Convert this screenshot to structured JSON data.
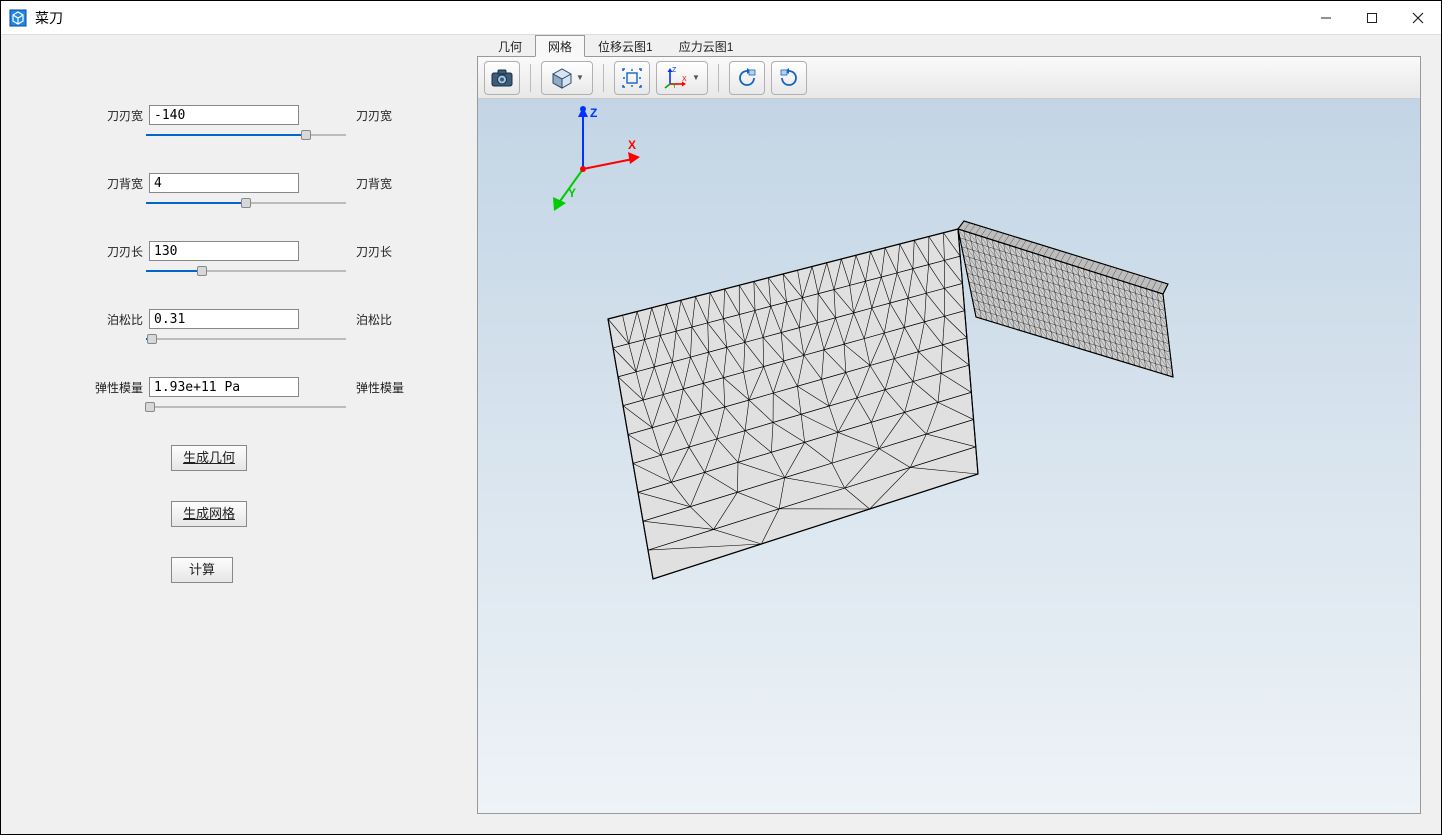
{
  "window": {
    "title": "菜刀"
  },
  "params": [
    {
      "label": "刀刃宽",
      "value": "-140",
      "label_r": "刀刃宽",
      "fill_pct": 80,
      "thumb_pct": 80
    },
    {
      "label": "刀背宽",
      "value": "4",
      "label_r": "刀背宽",
      "fill_pct": 50,
      "thumb_pct": 50
    },
    {
      "label": "刀刃长",
      "value": "130",
      "label_r": "刀刃长",
      "fill_pct": 28,
      "thumb_pct": 28
    },
    {
      "label": "泊松比",
      "value": "0.31",
      "label_r": "泊松比",
      "fill_pct": 3,
      "thumb_pct": 3
    },
    {
      "label": "弹性模量",
      "value": "1.93e+11 Pa",
      "label_r": "弹性模量",
      "fill_pct": 2,
      "thumb_pct": 2
    }
  ],
  "buttons": {
    "gen_geom": "生成几何",
    "gen_mesh": "生成网格",
    "compute": "计算"
  },
  "tabs": [
    {
      "label": "几何",
      "active": false
    },
    {
      "label": "网格",
      "active": true
    },
    {
      "label": "位移云图1",
      "active": false
    },
    {
      "label": "应力云图1",
      "active": false
    }
  ],
  "axes": {
    "x": "X",
    "y": "Y",
    "z": "Z"
  },
  "colors": {
    "slider_fill": "#0066cc",
    "axis_x": "#ff0000",
    "axis_y": "#00cc00",
    "axis_z": "#0033ff",
    "mesh_face": "#e0e0e0",
    "mesh_edge": "#000000",
    "bg_top": "#c3d5e5",
    "bg_bot": "#eef3f7"
  }
}
